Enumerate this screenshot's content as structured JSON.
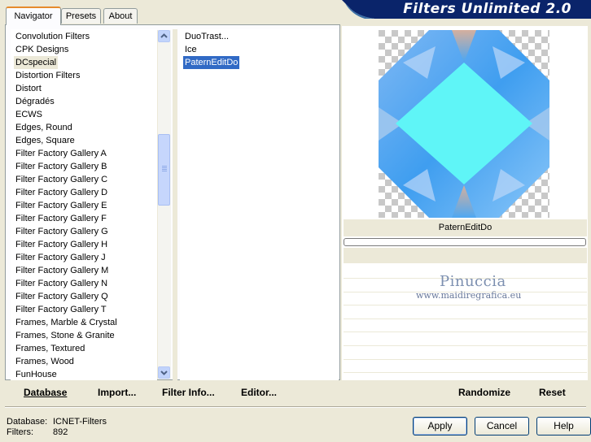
{
  "tabs": [
    {
      "label": "Navigator"
    },
    {
      "label": "Presets"
    },
    {
      "label": "About"
    }
  ],
  "banner": {
    "title": "Filters Unlimited 2.0"
  },
  "categories": [
    "Convolution Filters",
    "CPK Designs",
    "DCspecial",
    "Distortion Filters",
    "Distort",
    "Dégradés",
    "ECWS",
    "Edges, Round",
    "Edges, Square",
    "Filter Factory Gallery A",
    "Filter Factory Gallery B",
    "Filter Factory Gallery C",
    "Filter Factory Gallery D",
    "Filter Factory Gallery E",
    "Filter Factory Gallery F",
    "Filter Factory Gallery G",
    "Filter Factory Gallery H",
    "Filter Factory Gallery J",
    "Filter Factory Gallery M",
    "Filter Factory Gallery N",
    "Filter Factory Gallery Q",
    "Filter Factory Gallery T",
    "Frames, Marble & Crystal",
    "Frames, Stone & Granite",
    "Frames, Textured",
    "Frames, Wood",
    "FunHouse"
  ],
  "selected_category": "DCspecial",
  "filters": [
    "DuoTrast...",
    "Ice",
    "PaternEditDo"
  ],
  "selected_filter": "PaternEditDo",
  "preview": {
    "filter_name": "PaternEditDo"
  },
  "watermark": {
    "name": "Pinuccia",
    "site": "www.maidiregrafica.eu"
  },
  "toolbar": {
    "database": "Database",
    "import": "Import...",
    "filter_info": "Filter Info...",
    "editor": "Editor...",
    "randomize": "Randomize",
    "reset": "Reset"
  },
  "status": {
    "database_label": "Database:",
    "database_value": "ICNET-Filters",
    "filters_label": "Filters:",
    "filters_value": "892"
  },
  "buttons": {
    "apply": "Apply",
    "cancel": "Cancel",
    "help": "Help"
  },
  "colors": {
    "selection_blue": "#316ac5",
    "banner_navy": "#0a246a",
    "preview_cyan": "#5ff5f7"
  }
}
